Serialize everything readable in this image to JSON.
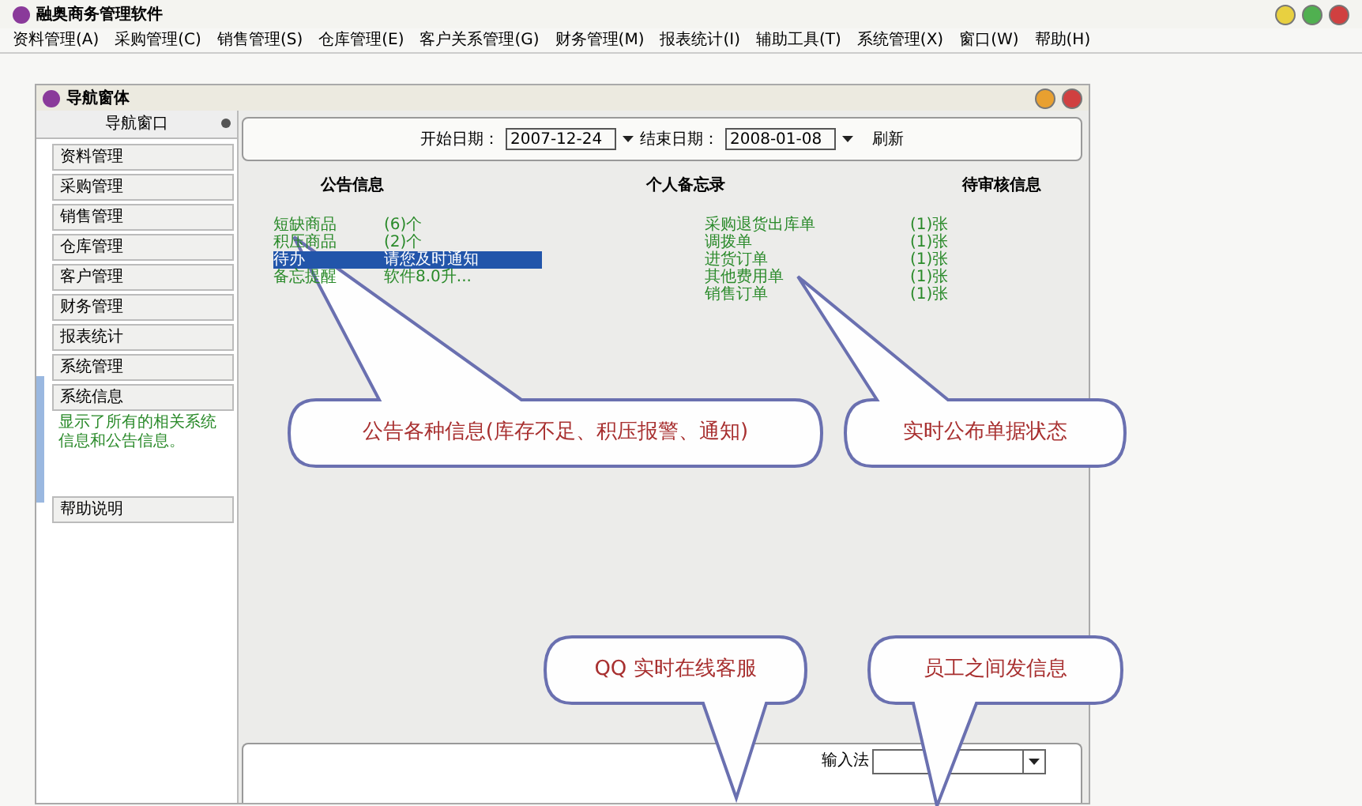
{
  "window": {
    "title": "融奥商务管理软件"
  },
  "menu": [
    "资料管理(A)",
    "采购管理(C)",
    "销售管理(S)",
    "仓库管理(E)",
    "客户关系管理(G)",
    "财务管理(M)",
    "报表统计(I)",
    "辅助工具(T)",
    "系统管理(X)",
    "窗口(W)",
    "帮助(H)"
  ],
  "nav_window": {
    "title": "导航窗体",
    "panel_title": "导航窗口",
    "items": [
      {
        "label": "资料管理",
        "kind": "button"
      },
      {
        "label": "采购管理",
        "kind": "button"
      },
      {
        "label": "销售管理",
        "kind": "button"
      },
      {
        "label": "仓库管理",
        "kind": "button"
      },
      {
        "label": "客户管理",
        "kind": "button"
      },
      {
        "label": "财务管理",
        "kind": "button"
      },
      {
        "label": "报表统计",
        "kind": "button"
      },
      {
        "label": "系统管理",
        "kind": "button"
      },
      {
        "label": "系统信息",
        "kind": "button"
      },
      {
        "label": "显示了所有的相关系统信息和公告信息。",
        "kind": "description"
      },
      {
        "label": "帮助说明",
        "kind": "button"
      }
    ]
  },
  "date_bar": {
    "start_label": "开始日期：",
    "start_value": "2007-12-24",
    "end_label": "结束日期：",
    "end_value": "2008-01-08",
    "refresh": "刷新"
  },
  "columns": [
    "公告信息",
    "个人备忘录",
    "待审核信息"
  ],
  "notices": [
    {
      "name": "短缺商品",
      "value": "(6)个",
      "selected": false
    },
    {
      "name": "积压商品",
      "value": "(2)个",
      "selected": false
    },
    {
      "name": "待办",
      "value": "请您及时通知",
      "selected": true
    },
    {
      "name": "备忘提醒",
      "value": "软件8.0升...",
      "selected": false
    }
  ],
  "pending": [
    {
      "name": "采购退货出库单",
      "value": "(1)张"
    },
    {
      "name": "调拨单",
      "value": "(1)张"
    },
    {
      "name": "进货订单",
      "value": "(1)张"
    },
    {
      "name": "其他费用单",
      "value": "(1)张"
    },
    {
      "name": "销售订单",
      "value": "(1)张"
    }
  ],
  "bottom_panel": {
    "input_label": "输入法"
  },
  "callouts": [
    "公告各种信息(库存不足、积压报警、通知)",
    "实时公布单据状态",
    "QQ 实时在线客服",
    "员工之间发信息"
  ]
}
